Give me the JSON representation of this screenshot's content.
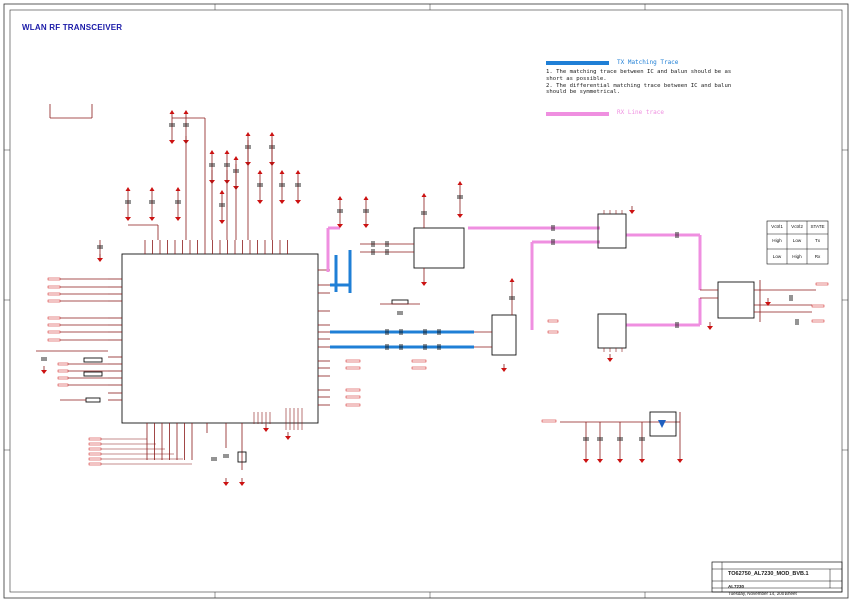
{
  "title": "WLAN RF TRANSCEIVER",
  "legend": {
    "tx_label": "TX Matching Trace",
    "tx_color": "#1f7fd6",
    "note1": "1. The matching trace between IC and balun should be as",
    "note1b": "short as possible.",
    "note2": "2. The differential matching trace between IC and balun",
    "note2b": "should be symmetrical.",
    "rx_label": "RX Line trace",
    "rx_color": "#ef8fe0"
  },
  "colors": {
    "wire": "#8b1a1a",
    "power": "#cc1111",
    "component": "#111111",
    "net_label": "#cc2222",
    "border": "#333333"
  },
  "truth_table": {
    "headers": [
      "Vctrl1",
      "Vctrl2",
      "STATE"
    ],
    "rows": [
      [
        "High",
        "Low",
        "Tx"
      ],
      [
        "Low",
        "High",
        "Rx"
      ]
    ]
  },
  "title_block": {
    "project": "TO62750_AL7230_MOD_BVB.1",
    "part": "AL7230",
    "date": "Tuesday, November 14, 2007",
    "sheet_label": "Sheet"
  }
}
